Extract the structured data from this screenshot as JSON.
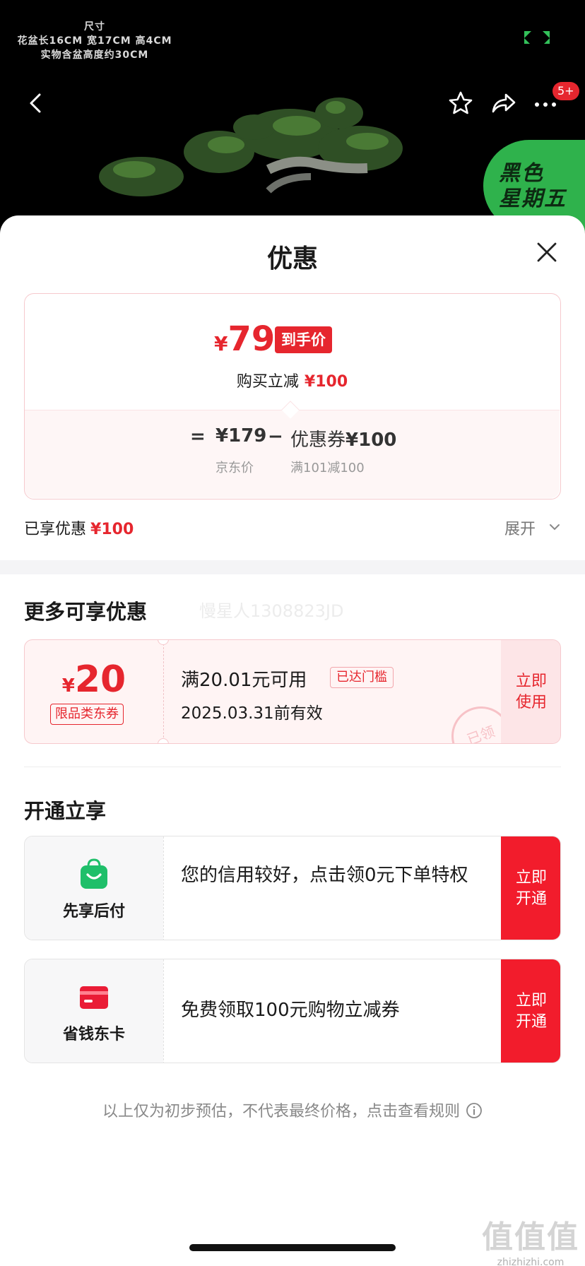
{
  "hero": {
    "dim_lines": [
      "尺寸",
      "花盆长16CM 宽17CM 高4CM",
      "实物含盆高度约30CM"
    ],
    "message_count": "5+",
    "black_friday_line1": "黑色",
    "black_friday_line2": "星期五"
  },
  "sheet": {
    "title": "优惠"
  },
  "price_card": {
    "currency": "¥",
    "final_price": "79",
    "final_tag": "到手价",
    "reduce_label": "购买立减",
    "reduce_amount": "¥100",
    "eq": "=",
    "jd_price": "¥179",
    "minus": "−",
    "coupon_label": "优惠券",
    "coupon_amount": "¥100",
    "jd_price_label": "京东价",
    "coupon_rule": "满101减100"
  },
  "enjoyed": {
    "label": "已享优惠",
    "amount": "¥100",
    "expand_label": "展开"
  },
  "more_offers": {
    "title": "更多可享优惠",
    "user_watermark": "慢星人1308823JD",
    "coupon": {
      "currency": "¥",
      "amount": "20",
      "type": "限品类东券",
      "condition": "满20.01元可用",
      "reached_tag": "已达门槛",
      "expire": "2025.03.31前有效",
      "stamp": "已领",
      "button_line1": "立即",
      "button_line2": "使用"
    }
  },
  "open_enjoy": {
    "title": "开通立享",
    "services": [
      {
        "name": "先享后付",
        "desc": "您的信用较好，点击领0元下单特权",
        "button_line1": "立即",
        "button_line2": "开通"
      },
      {
        "name": "省钱东卡",
        "desc": "免费领取100元购物立减券",
        "button_line1": "立即",
        "button_line2": "开通"
      }
    ]
  },
  "disclaimer": "以上仅为初步预估，不代表最终价格，点击查看规则",
  "site_mark": {
    "big": "值值值",
    "small": "zhizhizhi.com"
  },
  "colors": {
    "accent_red": "#e6262e",
    "button_red": "#f21c2c",
    "black_friday_green": "#2fb24c"
  }
}
